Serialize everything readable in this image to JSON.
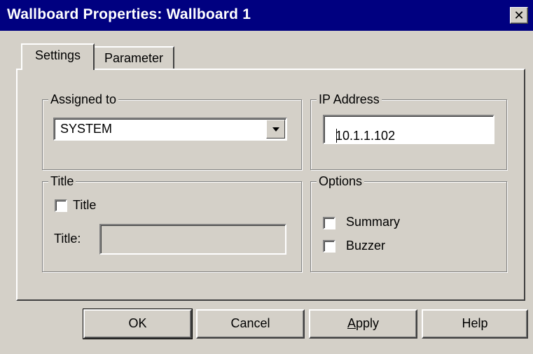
{
  "window": {
    "title": "Wallboard Properties: Wallboard  1",
    "close_glyph": "✕"
  },
  "tabs": [
    {
      "label": "Settings",
      "active": true
    },
    {
      "label": "Parameter",
      "active": false
    }
  ],
  "assigned_to": {
    "label": "Assigned to",
    "selected": "SYSTEM"
  },
  "ip_address": {
    "label": "IP Address",
    "value": "10.1.1.102"
  },
  "title_group": {
    "label": "Title",
    "checkbox_label": "Title",
    "checked": false,
    "field_label": "Title:",
    "field_value": ""
  },
  "options": {
    "label": "Options",
    "items": [
      {
        "label": "Summary",
        "checked": false
      },
      {
        "label": "Buzzer",
        "checked": false
      }
    ]
  },
  "buttons": {
    "ok": "OK",
    "cancel": "Cancel",
    "apply": "Apply",
    "help": "Help"
  },
  "colors": {
    "title_bar": "#000080",
    "face": "#d4d0c8"
  }
}
